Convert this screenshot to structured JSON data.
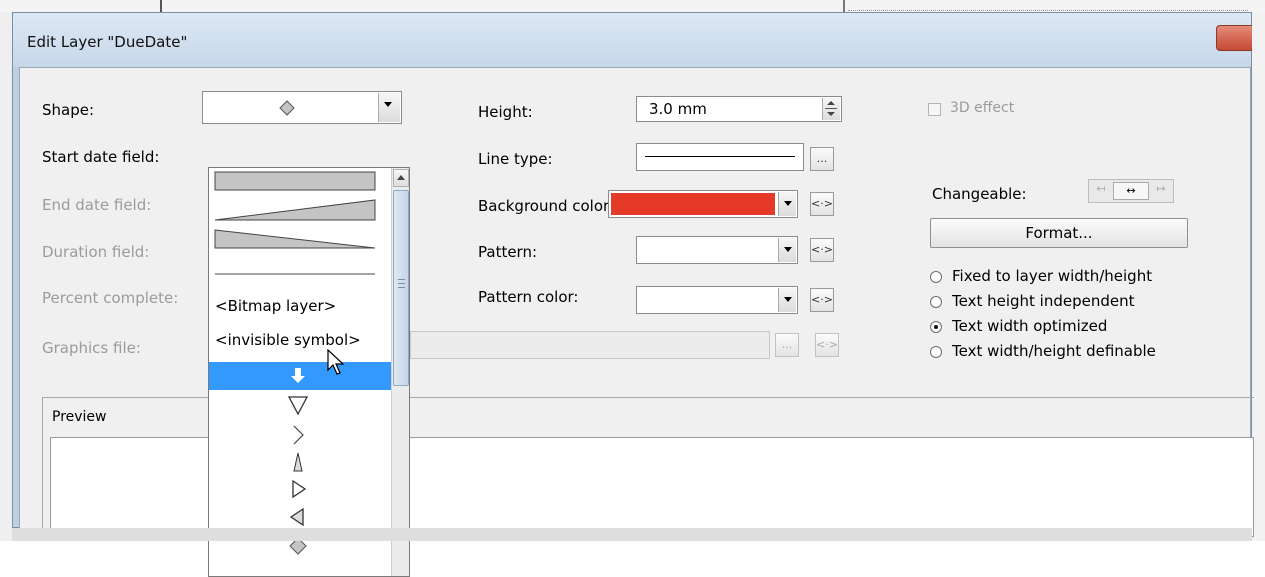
{
  "dialog": {
    "title": "Edit Layer \"DueDate\""
  },
  "left_labels": {
    "shape": "Shape:",
    "start_date": "Start date field:",
    "end_date": "End date field:",
    "duration": "Duration field:",
    "percent": "Percent complete:",
    "graphics": "Graphics file:"
  },
  "shape_combo": {
    "selected_icon": "diamond-icon"
  },
  "shape_list": {
    "items": [
      {
        "kind": "shape",
        "icon": "full-bar-shape-icon"
      },
      {
        "kind": "shape",
        "icon": "rising-wedge-shape-icon"
      },
      {
        "kind": "shape",
        "icon": "falling-wedge-shape-icon"
      },
      {
        "kind": "shape",
        "icon": "thin-line-shape-icon"
      },
      {
        "kind": "text",
        "label": "<Bitmap layer>"
      },
      {
        "kind": "text",
        "label": "<invisible symbol>"
      },
      {
        "kind": "symbol",
        "icon": "down-arrow-icon",
        "selected": true
      },
      {
        "kind": "symbol",
        "icon": "down-triangle-icon"
      },
      {
        "kind": "symbol",
        "icon": "chevron-right-icon"
      },
      {
        "kind": "symbol",
        "icon": "up-spike-icon"
      },
      {
        "kind": "symbol",
        "icon": "right-triangle-icon"
      },
      {
        "kind": "symbol",
        "icon": "left-triangle-icon"
      },
      {
        "kind": "symbol",
        "icon": "diamond-icon"
      }
    ]
  },
  "middle": {
    "height_label": "Height:",
    "height_value": "3.0 mm",
    "line_type_label": "Line type:",
    "bg_color_label": "Background color:",
    "bg_color": "#e53a28",
    "pattern_label": "Pattern:",
    "pattern_color_label": "Pattern color:",
    "ellipsis": "...",
    "reset_glyph": "<·>"
  },
  "right": {
    "effect_3d": "3D effect",
    "changeable_label": "Changeable:",
    "format_button": "Format...",
    "radios": [
      {
        "label": "Fixed to layer width/height",
        "checked": false
      },
      {
        "label": "Text height independent",
        "checked": false
      },
      {
        "label": "Text width optimized",
        "checked": true
      },
      {
        "label": "Text width/height definable",
        "checked": false
      }
    ]
  },
  "preview": {
    "label": "Preview"
  },
  "colors": {
    "accent": "#3399ff",
    "title_gradient_top": "#dde8f4",
    "window_bg": "#f0f0f0"
  }
}
